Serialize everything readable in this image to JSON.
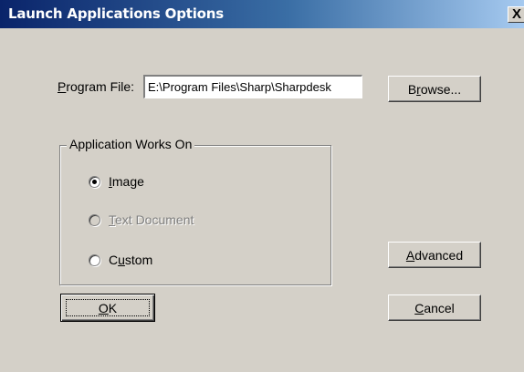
{
  "window": {
    "title": "Launch Applications Options",
    "close_glyph": "X"
  },
  "program_file": {
    "label_accel": "P",
    "label_rest": "rogram File:",
    "value": "E:\\Program Files\\Sharp\\Sharpdesk"
  },
  "buttons": {
    "browse_pre": "B",
    "browse_accel": "r",
    "browse_rest": "owse...",
    "advanced_accel": "A",
    "advanced_rest": "dvanced",
    "ok_accel": "O",
    "ok_rest": "K",
    "cancel_accel": "C",
    "cancel_rest": "ancel"
  },
  "group": {
    "title": "Application Works On",
    "options": [
      {
        "accel": "I",
        "rest": "mage",
        "pre": "",
        "selected": true,
        "enabled": true
      },
      {
        "accel": "T",
        "rest": "ext Document",
        "pre": "",
        "selected": false,
        "enabled": false
      },
      {
        "accel": "u",
        "rest": "stom",
        "pre": "C",
        "selected": false,
        "enabled": true
      }
    ]
  },
  "colors": {
    "title_bar_start": "#0a246a",
    "title_bar_end": "#a6caf0",
    "dialog_face": "#d4d0c8"
  }
}
